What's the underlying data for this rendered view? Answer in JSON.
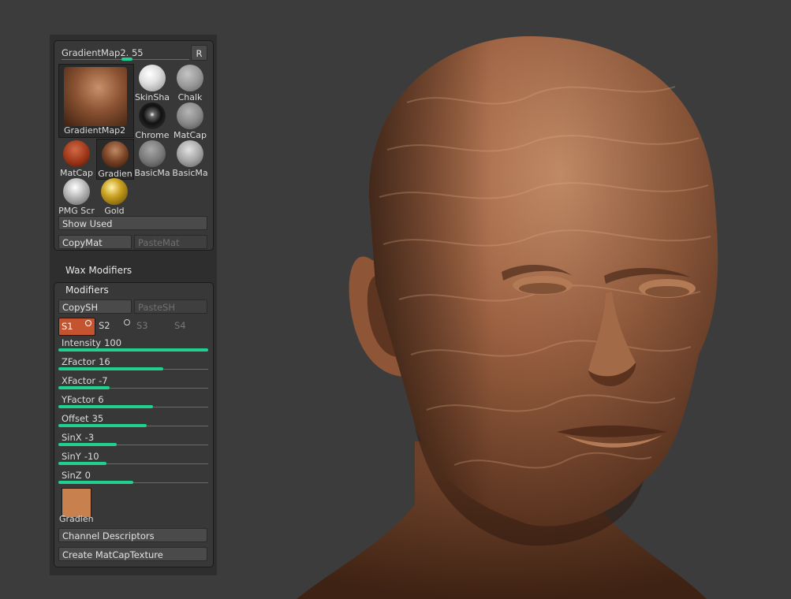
{
  "materials": {
    "current_label": "GradientMap2.",
    "current_value": "55",
    "current_value_fraction": 0.55,
    "r_button": "R",
    "big_preview_label": "GradientMap2",
    "grid": [
      {
        "label": "SkinSha",
        "icon": "skin-shade-sphere-icon"
      },
      {
        "label": "Chalk",
        "icon": "chalk-sphere-icon"
      },
      {
        "label": "Chrome",
        "icon": "chrome-sphere-icon"
      },
      {
        "label": "MatCap",
        "icon": "matcap-gray-sphere-icon"
      },
      {
        "label": "MatCap",
        "icon": "matcap-red-sphere-icon"
      },
      {
        "label": "Gradien",
        "icon": "gradient-map-sphere-icon"
      },
      {
        "label": "BasicMa",
        "icon": "basic-material-sphere-icon"
      },
      {
        "label": "BasicMa",
        "icon": "basic-material-2-sphere-icon"
      },
      {
        "label": "PMG Scr",
        "icon": "pmg-screen-sphere-icon"
      },
      {
        "label": "Gold",
        "icon": "gold-sphere-icon"
      }
    ],
    "show_used": "Show Used",
    "copy_mat": "CopyMat",
    "paste_mat": "PasteMat"
  },
  "wax_modifiers": "Wax Modifiers",
  "modifiers": {
    "title": "Modifiers",
    "copy_sh": "CopySH",
    "paste_sh": "PasteSH",
    "shaders": [
      "S1",
      "S2",
      "S3",
      "S4"
    ],
    "sliders": [
      {
        "label": "Intensity",
        "value": "100",
        "fraction": 1.0
      },
      {
        "label": "ZFactor",
        "value": "16",
        "fraction": 0.7
      },
      {
        "label": "XFactor",
        "value": "-7",
        "fraction": 0.34
      },
      {
        "label": "YFactor",
        "value": "6",
        "fraction": 0.63
      },
      {
        "label": "Offset",
        "value": "35",
        "fraction": 0.59
      },
      {
        "label": "SinX",
        "value": "-3",
        "fraction": 0.39
      },
      {
        "label": "SinY",
        "value": "-10",
        "fraction": 0.32
      },
      {
        "label": "SinZ",
        "value": "0",
        "fraction": 0.5
      }
    ],
    "gradient_label": "Gradien",
    "gradient_color": "#c9804f",
    "channel_descriptors": "Channel Descriptors",
    "create_matcap": "Create MatCapTexture"
  },
  "colors": {
    "slider_fill": "#1fd08e",
    "active_shader": "#c4532f",
    "canvas_bg": "#3c3c3d"
  }
}
